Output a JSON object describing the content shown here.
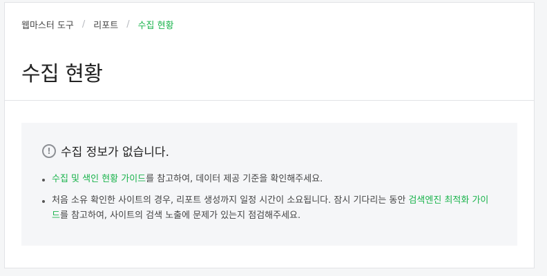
{
  "breadcrumb": {
    "items": [
      "웹마스터 도구",
      "리포트"
    ],
    "separator": "/",
    "current": "수집 현황"
  },
  "page_title": "수집 현황",
  "notice": {
    "icon": "alert-circle-icon",
    "title": "수집 정보가 없습니다.",
    "items": [
      {
        "link": "수집 및 색인 현황 가이드",
        "text": "를 참고하여, 데이터 제공 기준을 확인해주세요."
      },
      {
        "text_before": "처음 소유 확인한 사이트의 경우, 리포트 생성까지 일정 시간이 소요됩니다. 잠시 기다리는 동안 ",
        "link": "검색엔진 최적화 가이드",
        "text_after": "를 참고하여, 사이트의 검색 노출에 문제가 있는지 점검해주세요."
      }
    ]
  },
  "colors": {
    "accent": "#19b34b",
    "background": "#f5f6f7",
    "notice_bg": "#f5f6f8"
  }
}
